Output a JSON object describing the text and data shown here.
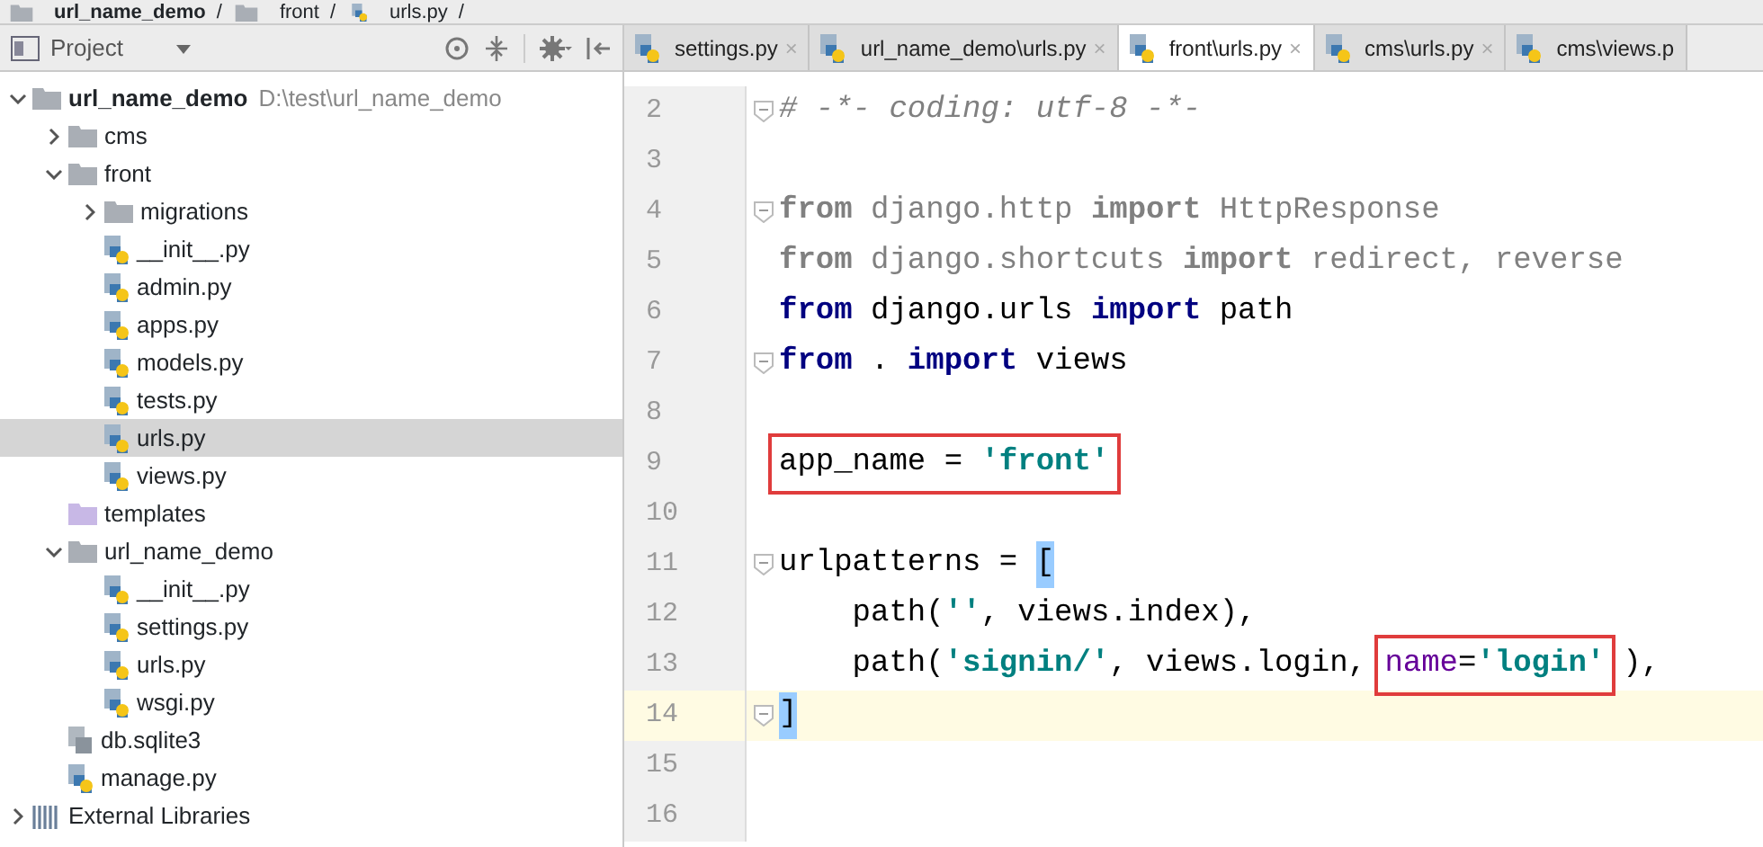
{
  "breadcrumb": [
    {
      "label": "url_name_demo",
      "kind": "project",
      "separator": "/"
    },
    {
      "label": "front",
      "kind": "folder",
      "separator": "/"
    },
    {
      "label": "urls.py",
      "kind": "py",
      "separator": "/"
    }
  ],
  "project_panel": {
    "title": "Project",
    "tree": [
      {
        "label": "url_name_demo",
        "kind": "project",
        "path": "D:\\test\\url_name_demo",
        "expanded": true,
        "selected": false,
        "children": [
          {
            "label": "cms",
            "kind": "folder",
            "expanded": false,
            "selected": false
          },
          {
            "label": "front",
            "kind": "folder",
            "expanded": true,
            "selected": false,
            "children": [
              {
                "label": "migrations",
                "kind": "folder",
                "expanded": false,
                "selected": false
              },
              {
                "label": "__init__.py",
                "kind": "py",
                "selected": false
              },
              {
                "label": "admin.py",
                "kind": "py",
                "selected": false
              },
              {
                "label": "apps.py",
                "kind": "py",
                "selected": false
              },
              {
                "label": "models.py",
                "kind": "py",
                "selected": false
              },
              {
                "label": "tests.py",
                "kind": "py",
                "selected": false
              },
              {
                "label": "urls.py",
                "kind": "py",
                "selected": true
              },
              {
                "label": "views.py",
                "kind": "py",
                "selected": false
              }
            ]
          },
          {
            "label": "templates",
            "kind": "template-folder",
            "selected": false
          },
          {
            "label": "url_name_demo",
            "kind": "folder",
            "expanded": true,
            "selected": false,
            "children": [
              {
                "label": "__init__.py",
                "kind": "py",
                "selected": false
              },
              {
                "label": "settings.py",
                "kind": "py",
                "selected": false
              },
              {
                "label": "urls.py",
                "kind": "py",
                "selected": false
              },
              {
                "label": "wsgi.py",
                "kind": "py",
                "selected": false
              }
            ]
          },
          {
            "label": "db.sqlite3",
            "kind": "db",
            "selected": false
          },
          {
            "label": "manage.py",
            "kind": "py",
            "selected": false
          }
        ]
      },
      {
        "label": "External Libraries",
        "kind": "libraries",
        "expanded": false,
        "selected": false
      }
    ]
  },
  "editor_tabs": [
    {
      "label": "settings.py",
      "selected": false,
      "close": "×"
    },
    {
      "label": "url_name_demo\\urls.py",
      "selected": false,
      "close": "×"
    },
    {
      "label": "front\\urls.py",
      "selected": true,
      "close": "×"
    },
    {
      "label": "cms\\urls.py",
      "selected": false,
      "close": "×"
    },
    {
      "label": "cms\\views.p",
      "selected": false
    }
  ],
  "code_lines": [
    {
      "number": "2",
      "fold": true,
      "current": false,
      "tokens": [
        {
          "text": "# -*- coding: utf-8 -*-",
          "kind": "comment",
          "boxed": false
        }
      ]
    },
    {
      "number": "3",
      "fold": false,
      "current": false
    },
    {
      "number": "4",
      "fold": true,
      "current": false,
      "tokens": [
        {
          "text": "from",
          "kind": "unused-keyword",
          "boxed": false
        },
        {
          "text": " django.http ",
          "kind": "unused",
          "boxed": false
        },
        {
          "text": "import",
          "kind": "unused-keyword",
          "boxed": false
        },
        {
          "text": " HttpResponse",
          "kind": "unused",
          "boxed": false
        }
      ]
    },
    {
      "number": "5",
      "fold": false,
      "current": false,
      "tokens": [
        {
          "text": "from",
          "kind": "unused-keyword",
          "boxed": false
        },
        {
          "text": " django.shortcuts ",
          "kind": "unused",
          "boxed": false
        },
        {
          "text": "import",
          "kind": "unused-keyword",
          "boxed": false
        },
        {
          "text": " redirect, reverse",
          "kind": "unused",
          "boxed": false
        }
      ]
    },
    {
      "number": "6",
      "fold": false,
      "current": false,
      "tokens": [
        {
          "text": "from",
          "kind": "keyword",
          "boxed": false
        },
        {
          "text": " django.urls ",
          "kind": "plain",
          "boxed": false
        },
        {
          "text": "import",
          "kind": "keyword",
          "boxed": false
        },
        {
          "text": " path",
          "kind": "plain",
          "boxed": false
        }
      ]
    },
    {
      "number": "7",
      "fold": true,
      "current": false,
      "tokens": [
        {
          "text": "from",
          "kind": "keyword",
          "boxed": false
        },
        {
          "text": " . ",
          "kind": "plain",
          "boxed": false
        },
        {
          "text": "import",
          "kind": "keyword",
          "boxed": false
        },
        {
          "text": " views",
          "kind": "plain",
          "boxed": false
        }
      ]
    },
    {
      "number": "8",
      "fold": false,
      "current": false
    },
    {
      "number": "9",
      "fold": false,
      "current": false,
      "tokens": [
        {
          "text": "app_name = ",
          "kind": "plain",
          "boxed": true
        },
        {
          "text": "'front'",
          "kind": "string",
          "boxed": true
        }
      ]
    },
    {
      "number": "10",
      "fold": false,
      "current": false
    },
    {
      "number": "11",
      "fold": true,
      "current": false,
      "tokens": [
        {
          "text": "urlpatterns = ",
          "kind": "plain",
          "boxed": false
        },
        {
          "text": "[",
          "kind": "bracket-match",
          "boxed": false
        }
      ]
    },
    {
      "number": "12",
      "fold": false,
      "current": false,
      "tokens": [
        {
          "text": "    path(",
          "kind": "plain",
          "boxed": false
        },
        {
          "text": "''",
          "kind": "string",
          "boxed": false
        },
        {
          "text": ", views.index),",
          "kind": "plain",
          "boxed": false
        }
      ]
    },
    {
      "number": "13",
      "fold": false,
      "current": false,
      "tokens": [
        {
          "text": "    path(",
          "kind": "plain",
          "boxed": false
        },
        {
          "text": "'signin/'",
          "kind": "string",
          "boxed": false
        },
        {
          "text": ", views.login, ",
          "kind": "plain",
          "boxed": false
        },
        {
          "text": "name",
          "kind": "param",
          "boxed": true
        },
        {
          "text": "=",
          "kind": "plain",
          "boxed": true
        },
        {
          "text": "'login'",
          "kind": "string",
          "boxed": true
        },
        {
          "text": "),",
          "kind": "plain",
          "boxed": false
        }
      ]
    },
    {
      "number": "14",
      "fold": true,
      "current": true,
      "tokens": [
        {
          "text": "]",
          "kind": "bracket-match",
          "boxed": false
        }
      ]
    },
    {
      "number": "15",
      "fold": false,
      "current": false
    },
    {
      "number": "16",
      "fold": false,
      "current": false
    }
  ]
}
